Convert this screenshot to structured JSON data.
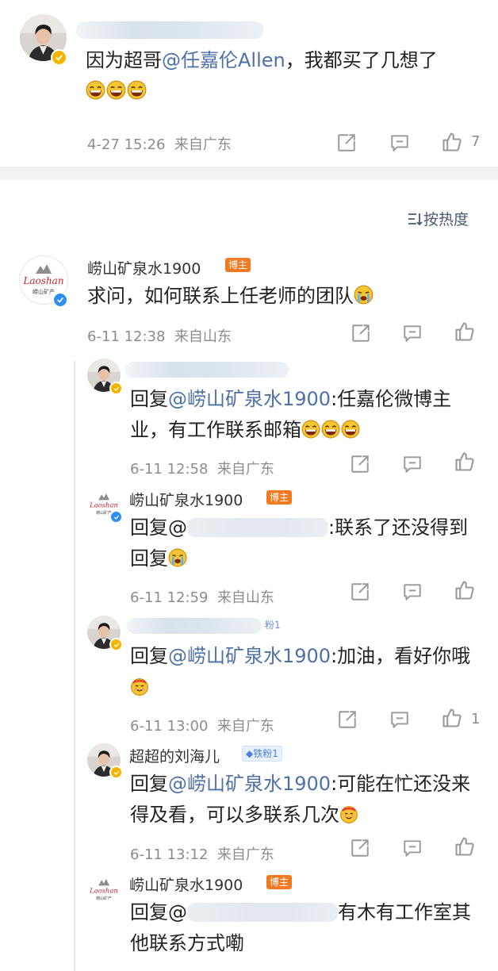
{
  "top_comment": {
    "text": "因为超哥",
    "mention": "@任嘉伦Allen",
    "text2": "，我都买了几想了",
    "time": "4-27 15:26",
    "location": "来自广东",
    "like_count": "7"
  },
  "sort": {
    "label": "按热度",
    "icon": "sort-icon"
  },
  "main_comment": {
    "user": "崂山矿泉水1900",
    "tag": "博主",
    "avatar_text": "Laoshan",
    "avatar_subtext": "崂山矿产",
    "text": "求问，如何联系上任老师的团队",
    "time": "6-11 12:38",
    "location": "来自山东"
  },
  "replies": [
    {
      "reply_prefix": "回复",
      "mention": "@崂山矿泉水1900",
      "text": ":任嘉伦微博主业，有工作联系邮箱",
      "time": "6-11 12:58",
      "location": "来自广东"
    },
    {
      "user": "崂山矿泉水1900",
      "tag": "博主",
      "reply_prefix": "回复@",
      "text": ":联系了还没得到回复",
      "time": "6-11 12:59",
      "location": "来自山东"
    },
    {
      "tag": "粉1",
      "reply_prefix": "回复",
      "mention": "@崂山矿泉水1900",
      "text": ":加油，看好你哦",
      "time": "6-11 13:00",
      "location": "来自广东",
      "like_count": "1"
    },
    {
      "user": "超超的刘海儿",
      "tag": "铁粉1",
      "reply_prefix": "回复",
      "mention": "@崂山矿泉水1900",
      "text": ":可能在忙还没来得及看，可以多联系几次",
      "time": "6-11 13:12",
      "location": "来自广东"
    },
    {
      "user": "崂山矿泉水1900",
      "tag": "博主",
      "reply_prefix": "回复@",
      "text": "有木有工作室其他联系方式嘞"
    }
  ],
  "colors": {
    "mention": "#4d70a8",
    "blogger_tag": "#f47a22",
    "fan_tag": "#4d7fd9",
    "verified": "#f5b400",
    "separator": "#f2f2f2"
  }
}
